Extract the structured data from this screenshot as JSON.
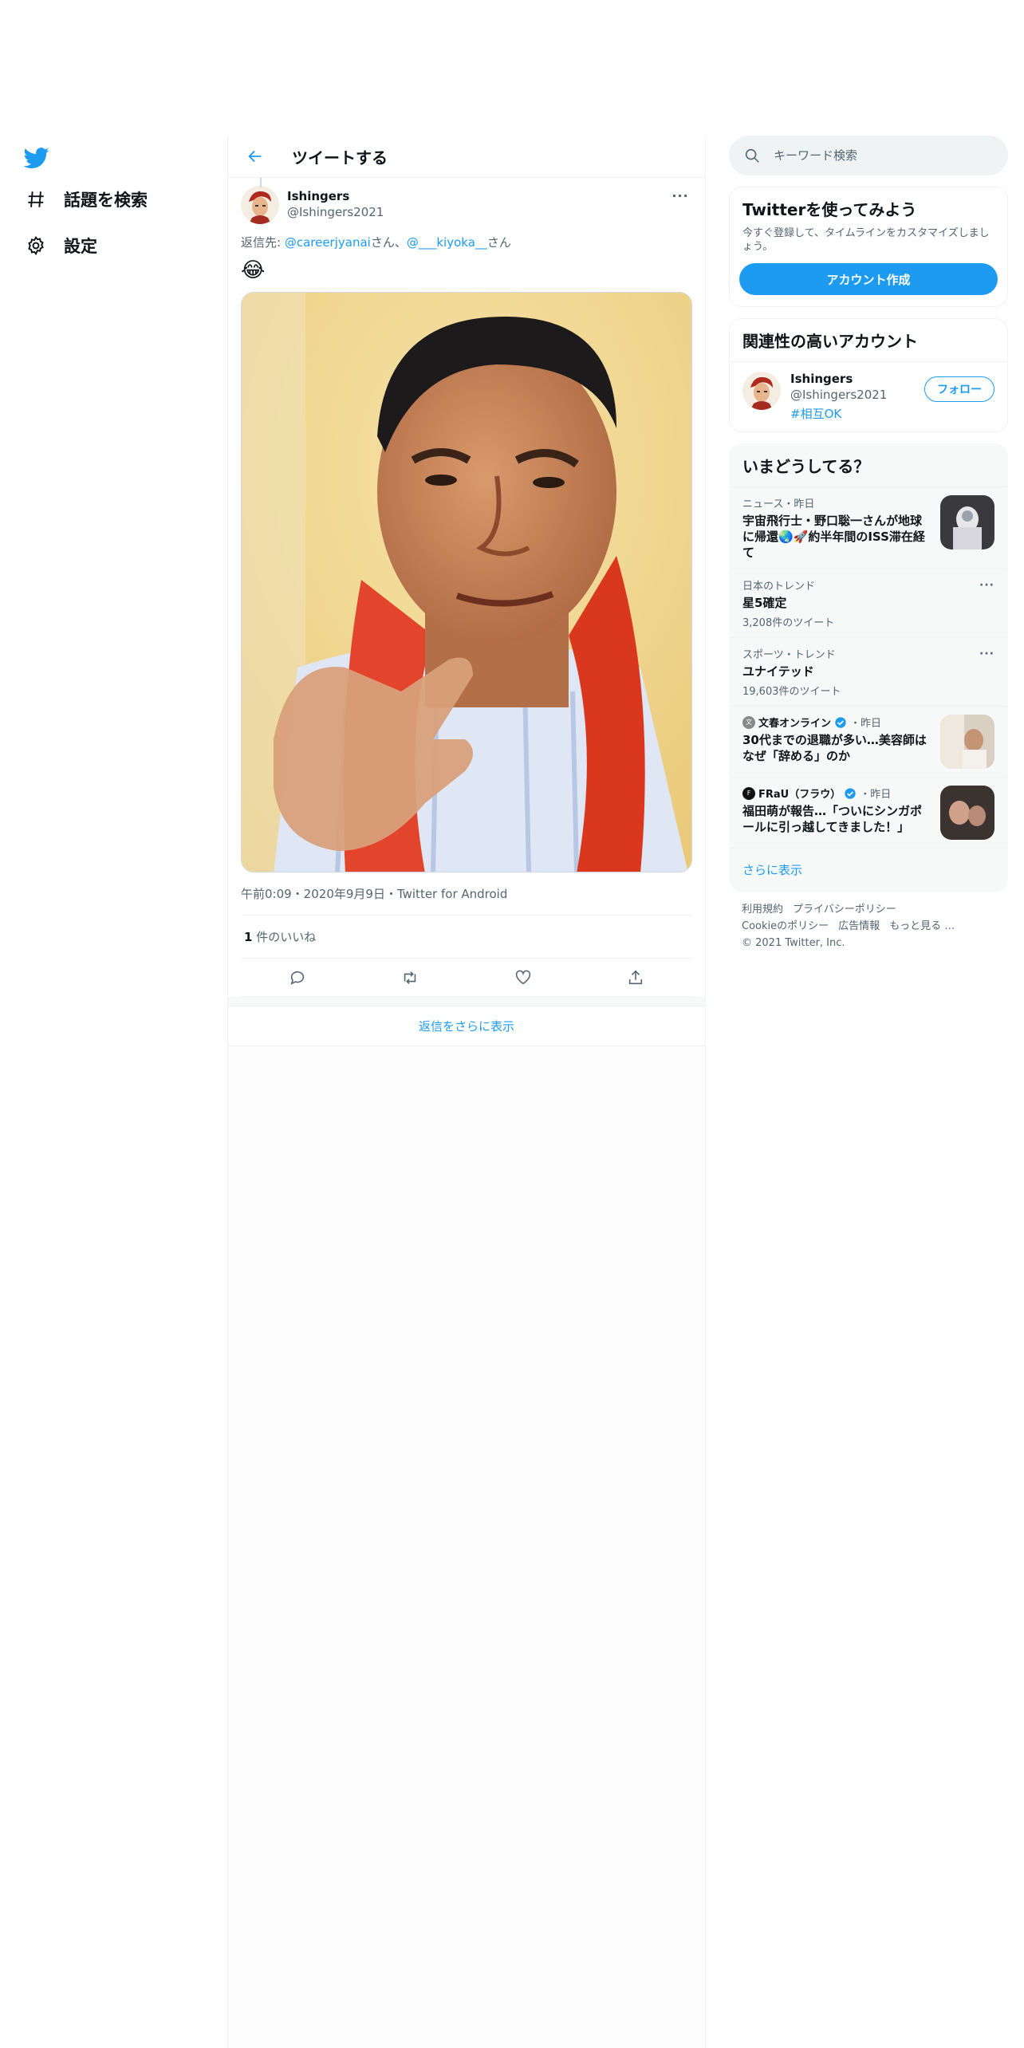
{
  "nav": {
    "items": [
      {
        "label": "話題を検索",
        "icon": "hashtag-icon"
      },
      {
        "label": "設定",
        "icon": "gear-icon"
      }
    ]
  },
  "header": {
    "title": "ツイートする"
  },
  "tweet": {
    "author_name": "Ishingers",
    "author_handle": "@Ishingers2021",
    "reply_prefix": "返信先: ",
    "reply_user1": "@careerjyanai",
    "reply_suffix1": "さん、",
    "reply_user2": "@___kiyoka__",
    "reply_suffix2": "さん",
    "emoji": "😂",
    "meta": "午前0:09・2020年9月9日・Twitter for Android",
    "likes_count": "1",
    "likes_label": " 件のいいね",
    "show_more_replies": "返信をさらに表示"
  },
  "search": {
    "placeholder": "キーワード検索"
  },
  "signup": {
    "title": "Twitterを使ってみよう",
    "subtitle": "今すぐ登録して、タイムラインをカスタマイズしましょう。",
    "button": "アカウント作成"
  },
  "related": {
    "title": "関連性の高いアカウント",
    "name": "Ishingers",
    "handle": "@Ishingers2021",
    "tag": "#相互OK",
    "follow": "フォロー"
  },
  "trends": {
    "title": "いまどうしてる？",
    "items": [
      {
        "meta": "ニュース・昨日",
        "title": "宇宙飛行士・野口聡一さんが地球に帰還🌏🚀約半年間のISS滞在経て"
      },
      {
        "meta": "日本のトレンド",
        "title": "星5確定",
        "count": "3,208件のツイート"
      },
      {
        "meta": "スポーツ・トレンド",
        "title": "ユナイテッド",
        "count": "19,603件のツイート"
      },
      {
        "source": "文春オンライン",
        "when": "・昨日",
        "title": "30代までの退職が多い…美容師はなぜ「辞める」のか"
      },
      {
        "source": "FRaU（フラウ）",
        "when": "・昨日",
        "title": "福田萌が報告…「ついにシンガポールに引っ越してきました！」"
      }
    ],
    "show_more": "さらに表示"
  },
  "footer": {
    "links": [
      "利用規約",
      "プライバシーポリシー",
      "Cookieのポリシー",
      "広告情報",
      "もっと見る …"
    ],
    "copyright": "© 2021 Twitter, Inc."
  },
  "colors": {
    "accent": "#1d9bf0",
    "text": "#0f1419",
    "muted": "#536471",
    "border": "#eff3f4"
  }
}
